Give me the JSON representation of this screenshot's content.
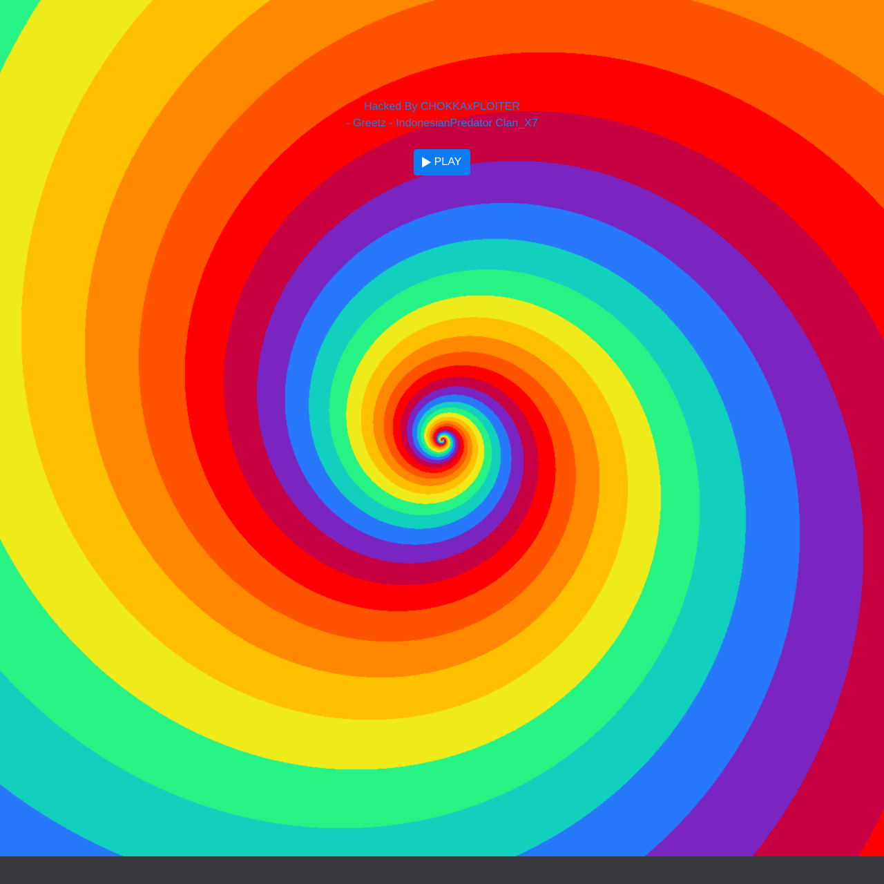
{
  "message": {
    "line1": "Hacked By CHOKKAxPLOITER",
    "line2": "- Greetz - IndonesianPredator Clan_X7"
  },
  "play_button": {
    "label": "PLAY",
    "icon": "play-icon"
  },
  "background": {
    "type": "rainbow-spiral",
    "colors": [
      "#c70041",
      "#7a25c2",
      "#2878fb",
      "#11d0be",
      "#27f284",
      "#efea19",
      "#ffc000",
      "#ff8800",
      "#ff5300",
      "#ff0000"
    ]
  },
  "colors": {
    "text": "#1e7fe6",
    "button": "#0d7bf2",
    "footer": "#36383d"
  }
}
